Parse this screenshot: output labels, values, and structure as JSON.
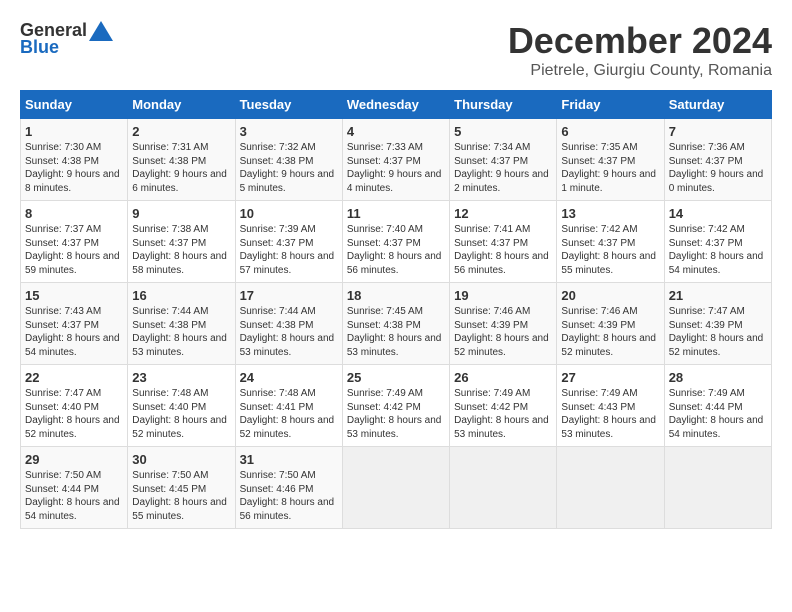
{
  "logo": {
    "general": "General",
    "blue": "Blue"
  },
  "title": "December 2024",
  "subtitle": "Pietrele, Giurgiu County, Romania",
  "days_header": [
    "Sunday",
    "Monday",
    "Tuesday",
    "Wednesday",
    "Thursday",
    "Friday",
    "Saturday"
  ],
  "weeks": [
    [
      {
        "day": "1",
        "sunrise": "Sunrise: 7:30 AM",
        "sunset": "Sunset: 4:38 PM",
        "daylight": "Daylight: 9 hours and 8 minutes."
      },
      {
        "day": "2",
        "sunrise": "Sunrise: 7:31 AM",
        "sunset": "Sunset: 4:38 PM",
        "daylight": "Daylight: 9 hours and 6 minutes."
      },
      {
        "day": "3",
        "sunrise": "Sunrise: 7:32 AM",
        "sunset": "Sunset: 4:38 PM",
        "daylight": "Daylight: 9 hours and 5 minutes."
      },
      {
        "day": "4",
        "sunrise": "Sunrise: 7:33 AM",
        "sunset": "Sunset: 4:37 PM",
        "daylight": "Daylight: 9 hours and 4 minutes."
      },
      {
        "day": "5",
        "sunrise": "Sunrise: 7:34 AM",
        "sunset": "Sunset: 4:37 PM",
        "daylight": "Daylight: 9 hours and 2 minutes."
      },
      {
        "day": "6",
        "sunrise": "Sunrise: 7:35 AM",
        "sunset": "Sunset: 4:37 PM",
        "daylight": "Daylight: 9 hours and 1 minute."
      },
      {
        "day": "7",
        "sunrise": "Sunrise: 7:36 AM",
        "sunset": "Sunset: 4:37 PM",
        "daylight": "Daylight: 9 hours and 0 minutes."
      }
    ],
    [
      {
        "day": "8",
        "sunrise": "Sunrise: 7:37 AM",
        "sunset": "Sunset: 4:37 PM",
        "daylight": "Daylight: 8 hours and 59 minutes."
      },
      {
        "day": "9",
        "sunrise": "Sunrise: 7:38 AM",
        "sunset": "Sunset: 4:37 PM",
        "daylight": "Daylight: 8 hours and 58 minutes."
      },
      {
        "day": "10",
        "sunrise": "Sunrise: 7:39 AM",
        "sunset": "Sunset: 4:37 PM",
        "daylight": "Daylight: 8 hours and 57 minutes."
      },
      {
        "day": "11",
        "sunrise": "Sunrise: 7:40 AM",
        "sunset": "Sunset: 4:37 PM",
        "daylight": "Daylight: 8 hours and 56 minutes."
      },
      {
        "day": "12",
        "sunrise": "Sunrise: 7:41 AM",
        "sunset": "Sunset: 4:37 PM",
        "daylight": "Daylight: 8 hours and 56 minutes."
      },
      {
        "day": "13",
        "sunrise": "Sunrise: 7:42 AM",
        "sunset": "Sunset: 4:37 PM",
        "daylight": "Daylight: 8 hours and 55 minutes."
      },
      {
        "day": "14",
        "sunrise": "Sunrise: 7:42 AM",
        "sunset": "Sunset: 4:37 PM",
        "daylight": "Daylight: 8 hours and 54 minutes."
      }
    ],
    [
      {
        "day": "15",
        "sunrise": "Sunrise: 7:43 AM",
        "sunset": "Sunset: 4:37 PM",
        "daylight": "Daylight: 8 hours and 54 minutes."
      },
      {
        "day": "16",
        "sunrise": "Sunrise: 7:44 AM",
        "sunset": "Sunset: 4:38 PM",
        "daylight": "Daylight: 8 hours and 53 minutes."
      },
      {
        "day": "17",
        "sunrise": "Sunrise: 7:44 AM",
        "sunset": "Sunset: 4:38 PM",
        "daylight": "Daylight: 8 hours and 53 minutes."
      },
      {
        "day": "18",
        "sunrise": "Sunrise: 7:45 AM",
        "sunset": "Sunset: 4:38 PM",
        "daylight": "Daylight: 8 hours and 53 minutes."
      },
      {
        "day": "19",
        "sunrise": "Sunrise: 7:46 AM",
        "sunset": "Sunset: 4:39 PM",
        "daylight": "Daylight: 8 hours and 52 minutes."
      },
      {
        "day": "20",
        "sunrise": "Sunrise: 7:46 AM",
        "sunset": "Sunset: 4:39 PM",
        "daylight": "Daylight: 8 hours and 52 minutes."
      },
      {
        "day": "21",
        "sunrise": "Sunrise: 7:47 AM",
        "sunset": "Sunset: 4:39 PM",
        "daylight": "Daylight: 8 hours and 52 minutes."
      }
    ],
    [
      {
        "day": "22",
        "sunrise": "Sunrise: 7:47 AM",
        "sunset": "Sunset: 4:40 PM",
        "daylight": "Daylight: 8 hours and 52 minutes."
      },
      {
        "day": "23",
        "sunrise": "Sunrise: 7:48 AM",
        "sunset": "Sunset: 4:40 PM",
        "daylight": "Daylight: 8 hours and 52 minutes."
      },
      {
        "day": "24",
        "sunrise": "Sunrise: 7:48 AM",
        "sunset": "Sunset: 4:41 PM",
        "daylight": "Daylight: 8 hours and 52 minutes."
      },
      {
        "day": "25",
        "sunrise": "Sunrise: 7:49 AM",
        "sunset": "Sunset: 4:42 PM",
        "daylight": "Daylight: 8 hours and 53 minutes."
      },
      {
        "day": "26",
        "sunrise": "Sunrise: 7:49 AM",
        "sunset": "Sunset: 4:42 PM",
        "daylight": "Daylight: 8 hours and 53 minutes."
      },
      {
        "day": "27",
        "sunrise": "Sunrise: 7:49 AM",
        "sunset": "Sunset: 4:43 PM",
        "daylight": "Daylight: 8 hours and 53 minutes."
      },
      {
        "day": "28",
        "sunrise": "Sunrise: 7:49 AM",
        "sunset": "Sunset: 4:44 PM",
        "daylight": "Daylight: 8 hours and 54 minutes."
      }
    ],
    [
      {
        "day": "29",
        "sunrise": "Sunrise: 7:50 AM",
        "sunset": "Sunset: 4:44 PM",
        "daylight": "Daylight: 8 hours and 54 minutes."
      },
      {
        "day": "30",
        "sunrise": "Sunrise: 7:50 AM",
        "sunset": "Sunset: 4:45 PM",
        "daylight": "Daylight: 8 hours and 55 minutes."
      },
      {
        "day": "31",
        "sunrise": "Sunrise: 7:50 AM",
        "sunset": "Sunset: 4:46 PM",
        "daylight": "Daylight: 8 hours and 56 minutes."
      },
      null,
      null,
      null,
      null
    ]
  ]
}
